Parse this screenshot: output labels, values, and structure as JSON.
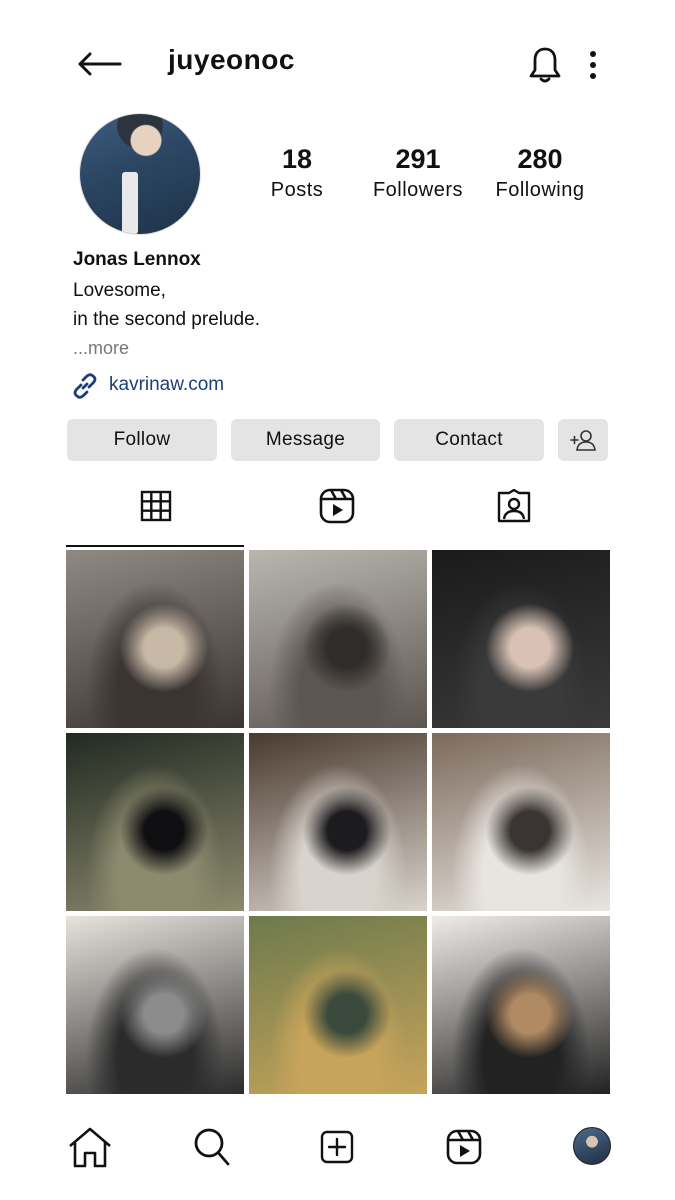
{
  "header": {
    "username": "juyeonoc",
    "back_icon": "arrow-left-icon",
    "bell_icon": "bell-icon",
    "more_icon": "more-vertical-icon"
  },
  "profile": {
    "avatar_icon": "profile-photo",
    "stats": [
      {
        "value": "18",
        "label": "Posts"
      },
      {
        "value": "291",
        "label": "Followers"
      },
      {
        "value": "280",
        "label": "Following"
      }
    ],
    "name": "Jonas Lennox",
    "bio_line1": "Lovesome,",
    "bio_line2": "in the second prelude.",
    "more": "...more",
    "link": "kavrinaw.com",
    "link_icon": "link-icon"
  },
  "actions": {
    "follow": "Follow",
    "message": "Message",
    "contact": "Contact",
    "add_user_icon": "add-user-icon"
  },
  "tabs": [
    {
      "name": "grid",
      "icon": "grid-icon",
      "active": true
    },
    {
      "name": "reels",
      "icon": "reels-icon",
      "active": false
    },
    {
      "name": "tagged",
      "icon": "tagged-icon",
      "active": false
    }
  ],
  "posts": [
    {
      "scene": "street-man-coat",
      "colors": [
        "#8f8a83",
        "#3b3532",
        "#c8b9a6"
      ]
    },
    {
      "scene": "paris-street-signs",
      "colors": [
        "#b9b6b0",
        "#5d5650",
        "#2f2d2c"
      ]
    },
    {
      "scene": "woman-dark-dress",
      "colors": [
        "#1a1a1a",
        "#3a3a3a",
        "#d9c2b5"
      ]
    },
    {
      "scene": "night-couple-walk",
      "colors": [
        "#222a22",
        "#8c8a6e",
        "#0f0f12"
      ]
    },
    {
      "scene": "friends-bar",
      "colors": [
        "#4a3a2e",
        "#d8d3cc",
        "#1c1b1d"
      ]
    },
    {
      "scene": "couple-closeup",
      "colors": [
        "#7c6a5c",
        "#e8e5e0",
        "#3a3532"
      ]
    },
    {
      "scene": "woman-gallery",
      "colors": [
        "#e7e3dd",
        "#2b2b2b",
        "#8c8c8c"
      ]
    },
    {
      "scene": "woman-painting",
      "colors": [
        "#6d7a4c",
        "#c7a45b",
        "#3a4a3c"
      ]
    },
    {
      "scene": "woman-holding-art",
      "colors": [
        "#efece8",
        "#222222",
        "#b08a63"
      ]
    }
  ],
  "bottom_nav": [
    {
      "name": "home",
      "icon": "home-icon"
    },
    {
      "name": "search",
      "icon": "search-icon"
    },
    {
      "name": "create",
      "icon": "create-icon"
    },
    {
      "name": "reels",
      "icon": "reels-icon"
    },
    {
      "name": "profile",
      "icon": "profile-avatar"
    }
  ]
}
